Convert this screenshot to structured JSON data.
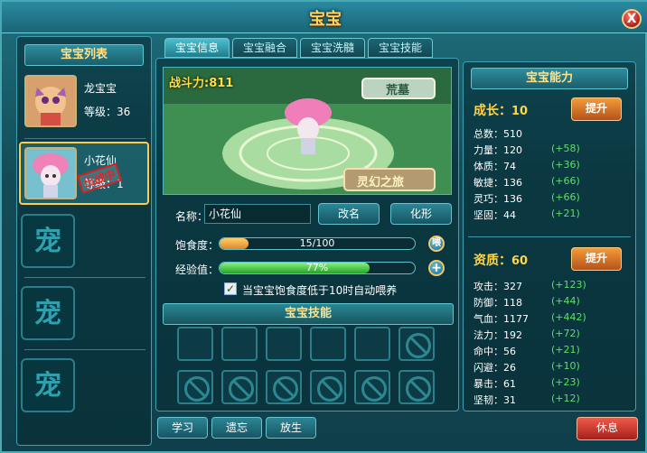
{
  "window": {
    "title": "宝宝",
    "close_label": "X"
  },
  "pet_list": {
    "header": "宝宝列表",
    "pets": [
      {
        "name": "龙宝宝",
        "level_label": "等级",
        "level": "36"
      },
      {
        "name": "小花仙",
        "level_label": "等级",
        "level": "1",
        "badge": "出战中"
      }
    ],
    "empty_slot_glyph": "宠"
  },
  "tabs": [
    "宝宝信息",
    "宝宝融合",
    "宝宝洗髓",
    "宝宝技能"
  ],
  "scene": {
    "combat_label": "战斗力",
    "combat_value": "811",
    "banner_top": "荒墓",
    "banner_bottom": "灵幻之旅"
  },
  "info": {
    "name_label": "名称",
    "name_value": "小花仙",
    "rename_button": "改名",
    "transform_button": "化形",
    "satiety_label": "饱食度",
    "satiety_text": "15/100",
    "satiety_fraction": 0.15,
    "feed_button": "喂",
    "exp_label": "经验值",
    "exp_text": "77%",
    "exp_fraction": 0.77,
    "exp_button": "+",
    "auto_feed_text": "当宝宝饱食度低于10时自动喂养",
    "auto_feed_checked": true
  },
  "skills": {
    "header": "宝宝技能",
    "learn_button": "学习",
    "forget_button": "遗忘",
    "release_button": "放生"
  },
  "abilities": {
    "header": "宝宝能力",
    "growth_label": "成长",
    "growth_value": "10",
    "upgrade_button": "提升",
    "growth_stats": [
      {
        "label": "总数",
        "value": "510",
        "bonus": ""
      },
      {
        "label": "力量",
        "value": "120",
        "bonus": "(+58)"
      },
      {
        "label": "体质",
        "value": "74",
        "bonus": "(+36)"
      },
      {
        "label": "敏捷",
        "value": "136",
        "bonus": "(+66)"
      },
      {
        "label": "灵巧",
        "value": "136",
        "bonus": "(+66)"
      },
      {
        "label": "坚固",
        "value": "44",
        "bonus": "(+21)"
      }
    ],
    "aptitude_label": "资质",
    "aptitude_value": "60",
    "aptitude_stats": [
      {
        "label": "攻击",
        "value": "327",
        "bonus": "(+123)"
      },
      {
        "label": "防御",
        "value": "118",
        "bonus": "(+44)"
      },
      {
        "label": "气血",
        "value": "1177",
        "bonus": "(+442)"
      },
      {
        "label": "法力",
        "value": "192",
        "bonus": "(+72)"
      },
      {
        "label": "命中",
        "value": "56",
        "bonus": "(+21)"
      },
      {
        "label": "闪避",
        "value": "26",
        "bonus": "(+10)"
      },
      {
        "label": "暴击",
        "value": "61",
        "bonus": "(+23)"
      },
      {
        "label": "坚韧",
        "value": "31",
        "bonus": "(+12)"
      }
    ],
    "rest_button": "休息"
  }
}
